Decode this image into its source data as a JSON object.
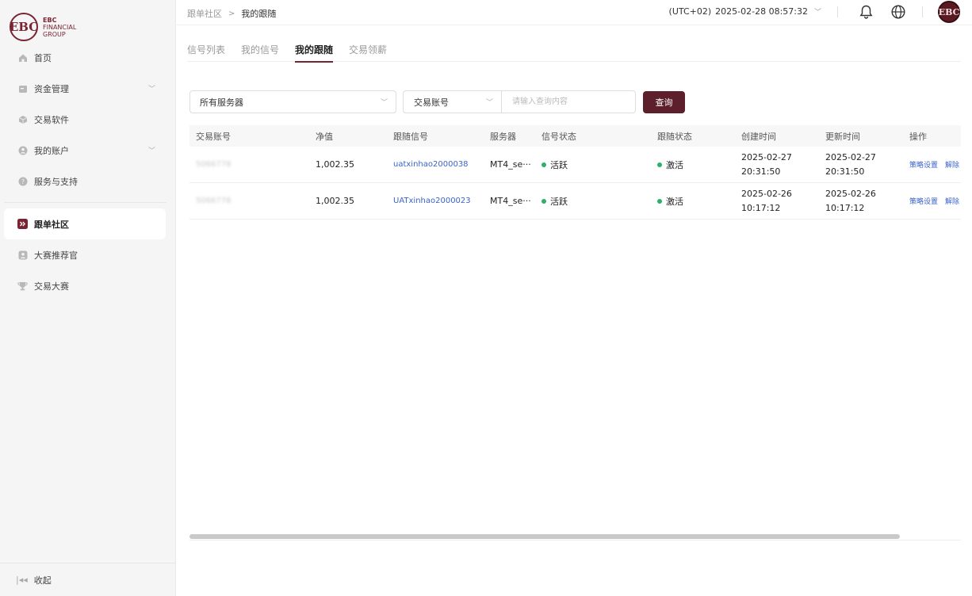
{
  "brand": {
    "mark": "EBC",
    "line1": "EBC",
    "line2": "FINANCIAL",
    "line3": "GROUP",
    "color": "#7a2433"
  },
  "sidebar": {
    "items": [
      {
        "label": "首页",
        "icon": "home-icon"
      },
      {
        "label": "资金管理",
        "icon": "wallet-icon"
      },
      {
        "label": "交易软件",
        "icon": "cube-icon"
      },
      {
        "label": "我的账户",
        "icon": "user-icon"
      },
      {
        "label": "服务与支持",
        "icon": "help-icon"
      },
      {
        "label": "跟单社区",
        "icon": "copy-trade-icon"
      },
      {
        "label": "大赛推荐官",
        "icon": "referral-icon"
      },
      {
        "label": "交易大赛",
        "icon": "trophy-icon"
      }
    ],
    "collapse_label": "收起"
  },
  "header": {
    "breadcrumb_root": "跟单社区",
    "breadcrumb_current": "我的跟随",
    "timezone": "(UTC+02)",
    "datetime": "2025-02-28 08:57:32"
  },
  "tabs": [
    "信号列表",
    "我的信号",
    "我的跟随",
    "交易领薪"
  ],
  "filters": {
    "server_select": "所有服务器",
    "search_type": "交易账号",
    "search_placeholder": "请输入查询内容",
    "query_button": "查询"
  },
  "table": {
    "columns": [
      "交易账号",
      "净值",
      "跟随信号",
      "服务器",
      "信号状态",
      "跟随状态",
      "创建时间",
      "更新时间",
      "操作"
    ],
    "rows": [
      {
        "account": "5066778",
        "equity": "1,002.35",
        "signal": "uatxinhao2000038",
        "server": "MT4_se···",
        "signal_status": "活跃",
        "follow_status": "激活",
        "created_date": "2025-02-27",
        "created_time": "20:31:50",
        "updated_date": "2025-02-27",
        "updated_time": "20:31:50",
        "op1": "策略设置",
        "op2": "解除"
      },
      {
        "account": "5066778",
        "equity": "1,002.35",
        "signal": "UATxinhao2000023",
        "server": "MT4_se···",
        "signal_status": "活跃",
        "follow_status": "激活",
        "created_date": "2025-02-26",
        "created_time": "10:17:12",
        "updated_date": "2025-02-26",
        "updated_time": "10:17:12",
        "op1": "策略设置",
        "op2": "解除"
      }
    ]
  },
  "colors": {
    "accent": "#7a2433",
    "button": "#5c1f2b",
    "link": "#3b64c8",
    "status_green": "#2eb06a"
  }
}
